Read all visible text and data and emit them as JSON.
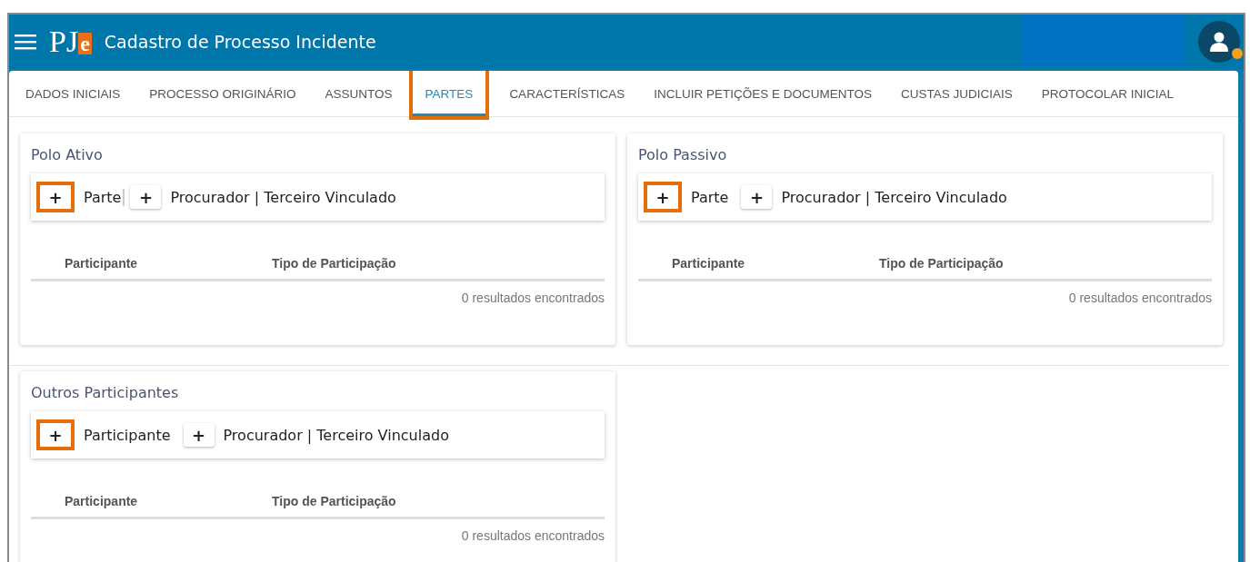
{
  "header": {
    "logo": {
      "text": "PJ",
      "badge": "e"
    },
    "title": "Cadastro de Processo Incidente"
  },
  "tabs": [
    {
      "label": "DADOS INICIAIS",
      "selected": false,
      "highlighted": false
    },
    {
      "label": "PROCESSO ORIGINÁRIO",
      "selected": false,
      "highlighted": false
    },
    {
      "label": "ASSUNTOS",
      "selected": false,
      "highlighted": false
    },
    {
      "label": "PARTES",
      "selected": true,
      "highlighted": true
    },
    {
      "label": "CARACTERÍSTICAS",
      "selected": false,
      "highlighted": false
    },
    {
      "label": "INCLUIR PETIÇÕES E DOCUMENTOS",
      "selected": false,
      "highlighted": false
    },
    {
      "label": "CUSTAS JUDICIAIS",
      "selected": false,
      "highlighted": false
    },
    {
      "label": "PROTOCOLAR INICIAL",
      "selected": false,
      "highlighted": false
    }
  ],
  "panels": [
    {
      "title": "Polo Ativo",
      "actions": [
        {
          "symbol": "+",
          "label": "Parte",
          "highlighted": true,
          "divider": true
        },
        {
          "symbol": "+",
          "label": "Procurador | Terceiro Vinculado",
          "highlighted": false,
          "divider": false
        }
      ],
      "columns": [
        "Participante",
        "Tipo de Participação"
      ],
      "footer": "0 resultados encontrados"
    },
    {
      "title": "Polo Passivo",
      "actions": [
        {
          "symbol": "+",
          "label": "Parte",
          "highlighted": true,
          "divider": false
        },
        {
          "symbol": "+",
          "label": "Procurador | Terceiro Vinculado",
          "highlighted": false,
          "divider": false
        }
      ],
      "columns": [
        "Participante",
        "Tipo de Participação"
      ],
      "footer": "0 resultados encontrados"
    },
    {
      "title": "Outros Participantes",
      "actions": [
        {
          "symbol": "+",
          "label": "Participante",
          "highlighted": true,
          "divider": false
        },
        {
          "symbol": "+",
          "label": "Procurador | Terceiro Vinculado",
          "highlighted": false,
          "divider": false
        }
      ],
      "columns": [
        "Participante",
        "Tipo de Participação"
      ],
      "footer": "0 resultados encontrados"
    }
  ]
}
